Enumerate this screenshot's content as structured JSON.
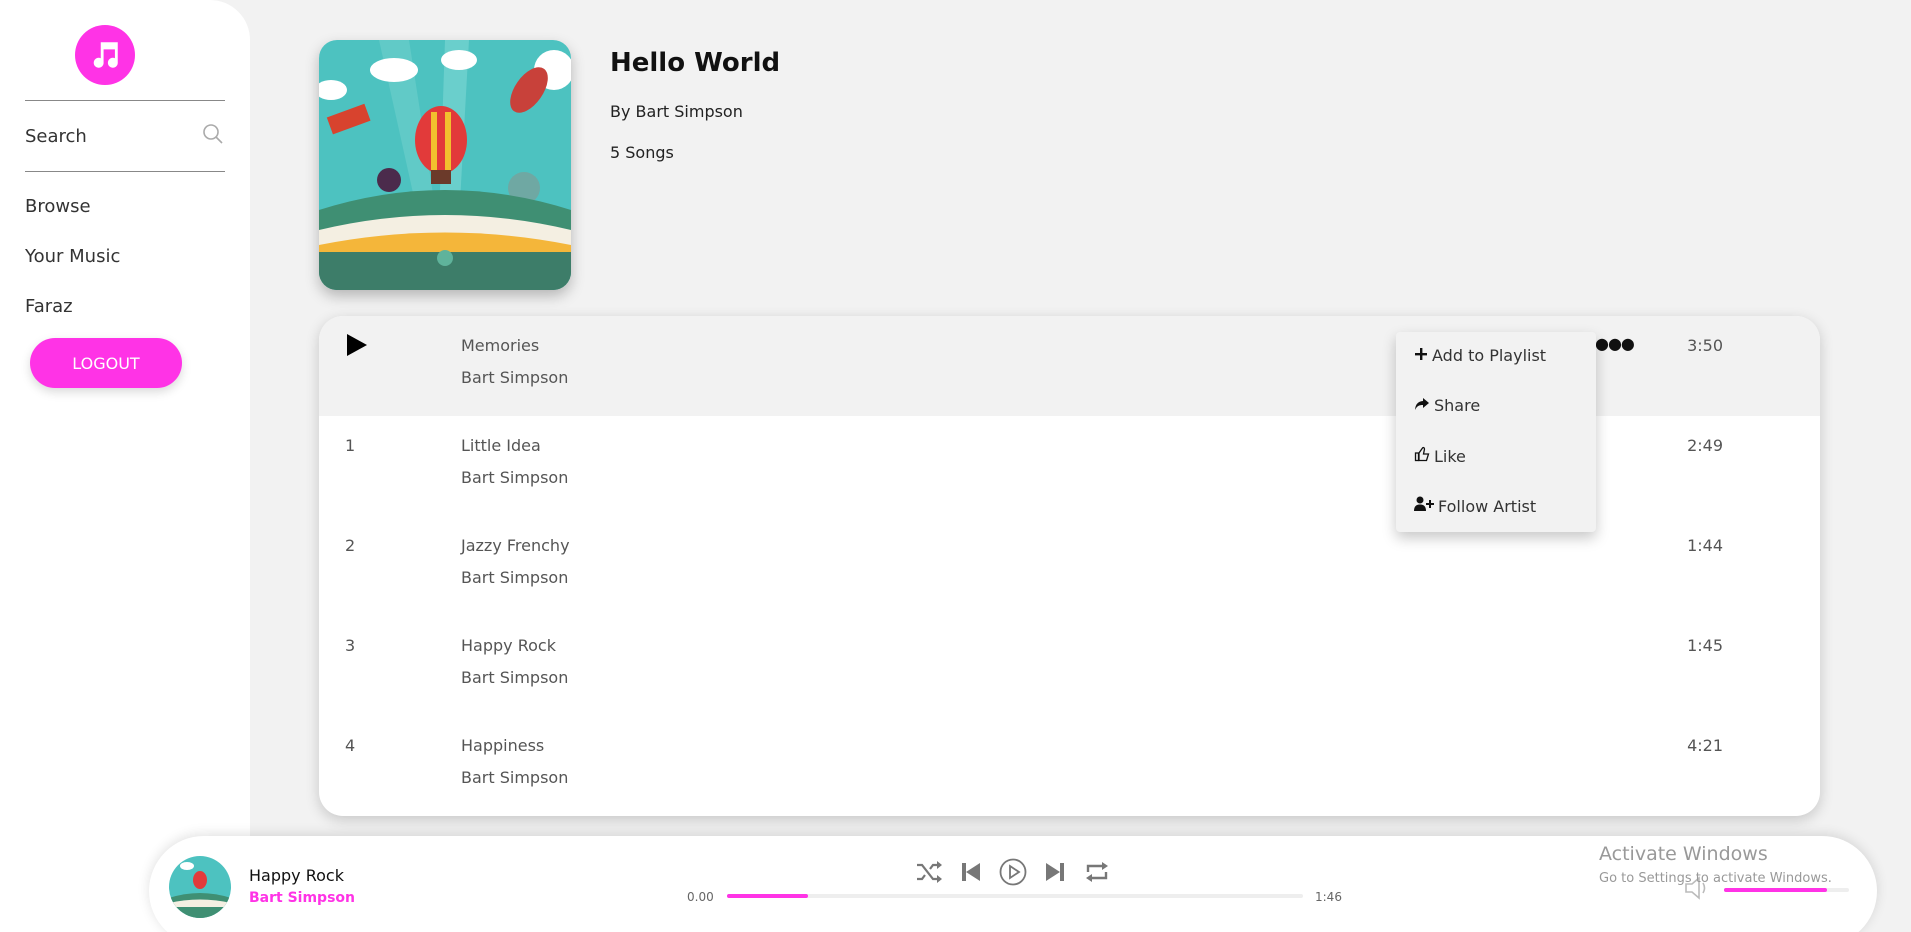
{
  "sidebar": {
    "search_label": "Search",
    "nav": [
      "Browse",
      "Your Music",
      "Faraz"
    ],
    "logout_label": "LOGOUT"
  },
  "album": {
    "title": "Hello World",
    "artist_line": "By Bart Simpson",
    "song_count": "5 Songs"
  },
  "tracks": [
    {
      "num": "",
      "title": "Memories",
      "artist": "Bart Simpson",
      "duration": "3:50",
      "active": true
    },
    {
      "num": "1",
      "title": "Little Idea",
      "artist": "Bart Simpson",
      "duration": "2:49"
    },
    {
      "num": "2",
      "title": "Jazzy Frenchy",
      "artist": "Bart Simpson",
      "duration": "1:44"
    },
    {
      "num": "3",
      "title": "Happy Rock",
      "artist": "Bart Simpson",
      "duration": "1:45"
    },
    {
      "num": "4",
      "title": "Happiness",
      "artist": "Bart Simpson",
      "duration": "4:21"
    }
  ],
  "context_menu": {
    "items": [
      "Add to Playlist",
      "Share",
      "Like",
      "Follow Artist"
    ]
  },
  "player": {
    "title": "Happy Rock",
    "artist": "Bart Simpson",
    "time_current": "0.00",
    "time_total": "1:46",
    "progress_fraction": 0.14,
    "volume_fraction": 0.82
  },
  "watermark": {
    "title": "Activate Windows",
    "subtitle": "Go to Settings to activate Windows."
  },
  "colors": {
    "accent": "#ff33e6",
    "background": "#f2f2f2"
  }
}
